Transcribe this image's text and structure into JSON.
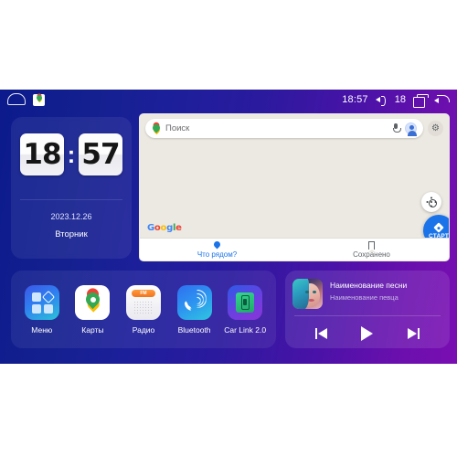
{
  "statusbar": {
    "home_icon": "home-icon",
    "maps_app_icon": "maps-pin-icon",
    "time": "18:57",
    "volume_icon": "volume-icon",
    "volume_level": "18",
    "recents_icon": "recent-apps-icon",
    "back_icon": "back-arrow-icon"
  },
  "clock_widget": {
    "hours": "18",
    "minutes": "57",
    "separator": ":",
    "date": "2023.12.26",
    "weekday": "Вторник"
  },
  "maps_panel": {
    "search": {
      "placeholder": "Поиск",
      "pin_icon": "maps-pin-icon",
      "mic_icon": "microphone-icon",
      "avatar_icon": "account-avatar-icon"
    },
    "settings_icon": "gear-icon",
    "gear_glyph": "⚙",
    "watermark": [
      "G",
      "o",
      "o",
      "g",
      "l",
      "e"
    ],
    "locate_icon": "locate-me-icon",
    "start_button": {
      "label": "СТАРТ",
      "icon": "navigation-diamond-icon"
    },
    "bottom_nav": [
      {
        "label": "Что рядом?",
        "icon": "pin-icon",
        "active": true
      },
      {
        "label": "Сохранено",
        "icon": "bookmark-icon",
        "active": false
      }
    ]
  },
  "app_dock": {
    "apps": [
      {
        "label": "Меню",
        "icon": "menu-grid-icon"
      },
      {
        "label": "Карты",
        "icon": "google-maps-icon"
      },
      {
        "label": "Радио",
        "icon": "radio-icon",
        "badge": "FM"
      },
      {
        "label": "Bluetooth",
        "icon": "bluetooth-phone-icon"
      },
      {
        "label": "Car Link 2.0",
        "icon": "car-link-icon"
      }
    ]
  },
  "music_widget": {
    "album_art": "album-art-portrait",
    "title": "Наименование песни",
    "artist": "Наименование певца",
    "controls": [
      {
        "name": "previous-track",
        "icon": "skip-previous-icon"
      },
      {
        "name": "play",
        "icon": "play-icon"
      },
      {
        "name": "next-track",
        "icon": "skip-next-icon"
      }
    ]
  },
  "colors": {
    "accent_blue": "#1a73e8",
    "bg_left": "#0b1a8c",
    "bg_right": "#7a0eb2",
    "map_bg": "#ece9e2"
  }
}
